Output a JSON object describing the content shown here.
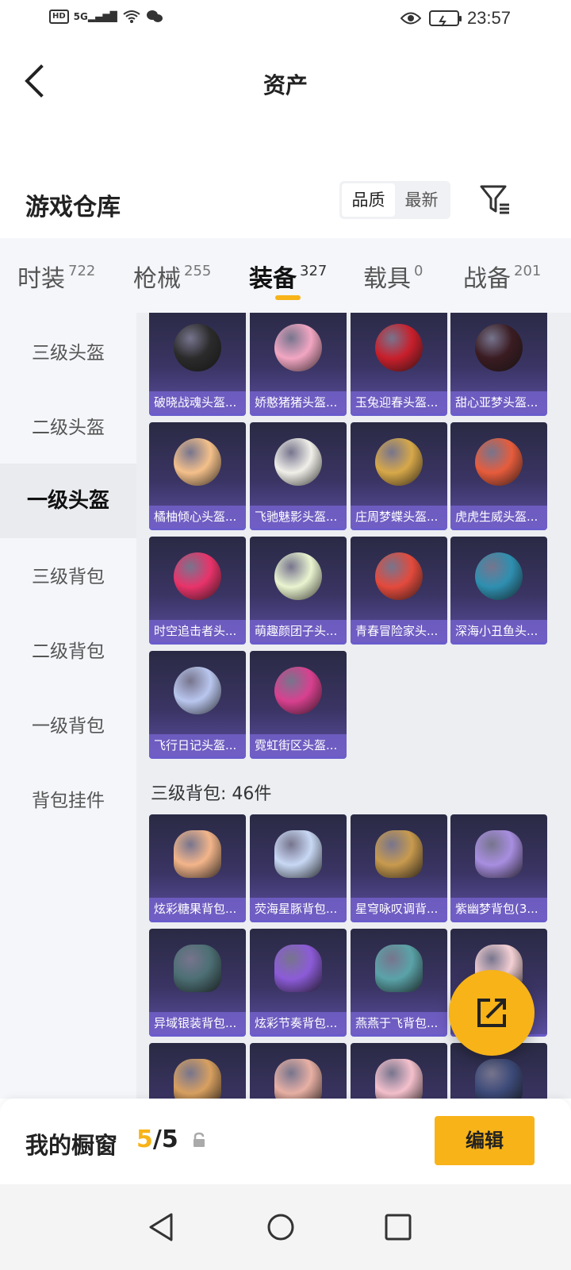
{
  "status_bar": {
    "left_icons": [
      "hd-icon",
      "5g-signal-icon",
      "wifi-icon",
      "wechat-icon"
    ],
    "hd": "HD",
    "network": "5G",
    "time": "23:57"
  },
  "header": {
    "title": "资产"
  },
  "section": {
    "title": "游戏仓库",
    "sort_options": [
      "品质",
      "最新"
    ],
    "sort_selected": "品质"
  },
  "tabs": [
    {
      "label": "时装",
      "count": "722"
    },
    {
      "label": "枪械",
      "count": "255"
    },
    {
      "label": "装备",
      "count": "327",
      "active": true
    },
    {
      "label": "载具",
      "count": "0"
    },
    {
      "label": "战备",
      "count": "201"
    }
  ],
  "sidebar": [
    {
      "label": "三级头盔"
    },
    {
      "label": "二级头盔"
    },
    {
      "label": "一级头盔",
      "active": true
    },
    {
      "label": "三级背包"
    },
    {
      "label": "二级背包"
    },
    {
      "label": "一级背包"
    },
    {
      "label": "背包挂件"
    }
  ],
  "helmets": [
    {
      "name": "破晓战魂头盔...",
      "color": "#2b2b2b"
    },
    {
      "name": "娇憨猪猪头盔...",
      "color": "#f2a6c2"
    },
    {
      "name": "玉兔迎春头盔...",
      "color": "#c81f2b"
    },
    {
      "name": "甜心亚梦头盔...",
      "color": "#3a1c22"
    },
    {
      "name": "橘柚倾心头盔...",
      "color": "#f4c08a"
    },
    {
      "name": "飞驰魅影头盔...",
      "color": "#f0efe8"
    },
    {
      "name": "庄周梦蝶头盔...",
      "color": "#d7a849"
    },
    {
      "name": "虎虎生威头盔...",
      "color": "#e65c3c"
    },
    {
      "name": "时空追击者头...",
      "color": "#e8336a"
    },
    {
      "name": "萌趣颜团子头...",
      "color": "#eaf4d0"
    },
    {
      "name": "青春冒险家头...",
      "color": "#e34a3c"
    },
    {
      "name": "深海小丑鱼头...",
      "color": "#2e8fb0"
    },
    {
      "name": "飞行日记头盔...",
      "color": "#b9c6ee"
    },
    {
      "name": "霓虹街区头盔...",
      "color": "#d8408f"
    }
  ],
  "backpack_group_label": "三级背包: 46件",
  "backpacks": [
    {
      "name": "炫彩糖果背包...",
      "color": "#f3b58a"
    },
    {
      "name": "荧海星豚背包...",
      "color": "#c8d8f4"
    },
    {
      "name": "星穹咏叹调背...",
      "color": "#c89a4e"
    },
    {
      "name": "紫幽梦背包(3...",
      "color": "#a88ee0"
    },
    {
      "name": "异域银装背包...",
      "color": "#4c6f74"
    },
    {
      "name": "炫彩节奏背包...",
      "color": "#8c5bd8"
    },
    {
      "name": "燕燕于飞背包...",
      "color": "#5aa3a8"
    },
    {
      "name": "",
      "color": "#f4d0d4"
    },
    {
      "name": "",
      "color": "#d8a060"
    },
    {
      "name": "",
      "color": "#e8b0a4"
    },
    {
      "name": "",
      "color": "#f4c0cc"
    },
    {
      "name": "",
      "color": "#3c4a78"
    }
  ],
  "bottom": {
    "showcase_label": "我的橱窗",
    "current": "5",
    "separator": "/",
    "total": "5",
    "edit_label": "编辑"
  },
  "colors": {
    "accent": "#f7b318",
    "card_bg": "#3a3463",
    "sidebar_bg": "#f4f6fa"
  }
}
